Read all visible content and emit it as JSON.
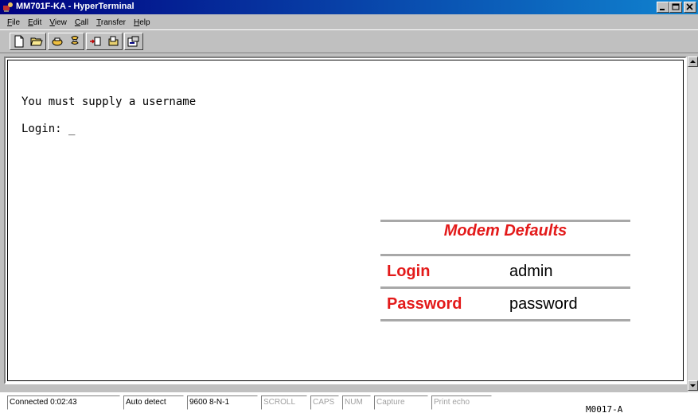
{
  "window": {
    "title": "MM701F-KA - HyperTerminal",
    "controls": [
      "_",
      "□",
      "×"
    ]
  },
  "menu": [
    {
      "label": "File",
      "key": "F",
      "rest": "ile"
    },
    {
      "label": "Edit",
      "key": "E",
      "rest": "dit"
    },
    {
      "label": "View",
      "key": "V",
      "rest": "iew"
    },
    {
      "label": "Call",
      "key": "C",
      "rest": "all"
    },
    {
      "label": "Transfer",
      "key": "T",
      "rest": "ransfer"
    },
    {
      "label": "Help",
      "key": "H",
      "rest": "elp"
    }
  ],
  "toolbar": {
    "icons": [
      "new-icon",
      "open-icon",
      "connect-icon",
      "disconnect-icon",
      "send-icon",
      "receive-icon",
      "properties-icon"
    ]
  },
  "terminal": {
    "line1": "You must supply a username",
    "line2": "Login: _"
  },
  "defaults": {
    "title": "Modem Defaults",
    "login_label": "Login",
    "login_value": "admin",
    "password_label": "Password",
    "password_value": "password"
  },
  "status": {
    "connected": "Connected 0:02:43",
    "detect": "Auto detect",
    "settings": "9600 8-N-1",
    "scroll": "SCROLL",
    "caps": "CAPS",
    "num": "NUM",
    "capture": "Capture",
    "print_echo": "Print echo"
  },
  "figure_code": "M0017-A",
  "colors": {
    "titlebar_start": "#000080",
    "titlebar_end": "#1084d0",
    "defaults_accent": "#e31a1a"
  }
}
